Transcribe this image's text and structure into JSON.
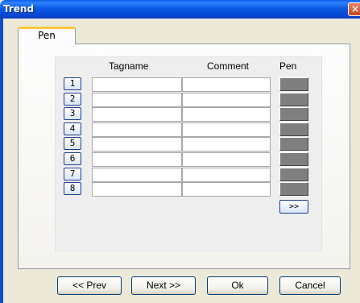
{
  "window": {
    "title": "Trend",
    "close_glyph": "×"
  },
  "tabs": [
    {
      "label": "Pen"
    }
  ],
  "table": {
    "headers": {
      "tagname": "Tagname",
      "comment": "Comment",
      "pen": "Pen"
    },
    "rows": [
      {
        "number": "1",
        "tagname": "",
        "comment": ""
      },
      {
        "number": "2",
        "tagname": "",
        "comment": ""
      },
      {
        "number": "3",
        "tagname": "",
        "comment": ""
      },
      {
        "number": "4",
        "tagname": "",
        "comment": ""
      },
      {
        "number": "5",
        "tagname": "",
        "comment": ""
      },
      {
        "number": "6",
        "tagname": "",
        "comment": ""
      },
      {
        "number": "7",
        "tagname": "",
        "comment": ""
      },
      {
        "number": "8",
        "tagname": "",
        "comment": ""
      }
    ],
    "pen_color": "#7f7f7f",
    "more_label": ">>"
  },
  "buttons": {
    "prev": "<< Prev",
    "next": "Next >>",
    "ok": "Ok",
    "cancel": "Cancel"
  }
}
